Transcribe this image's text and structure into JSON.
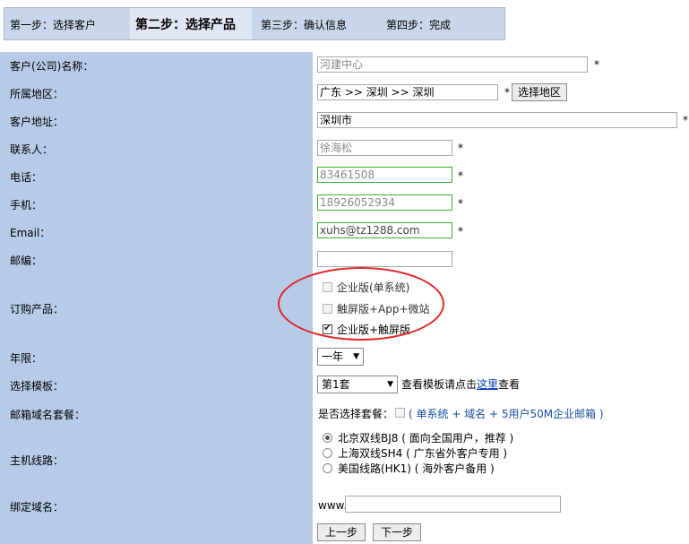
{
  "steps": {
    "step1": "第一步：选择客户",
    "step2": "第二步：选择产品",
    "step3": "第三步：确认信息",
    "step4": "第四步：完成"
  },
  "form": {
    "company": {
      "label": "客户(公司)名称：",
      "value": "河建中心",
      "required": "*"
    },
    "region": {
      "label": "所属地区：",
      "value": "广东 >> 深圳 >> 深圳",
      "required": "*",
      "button": "选择地区"
    },
    "address": {
      "label": "客户地址：",
      "value": "深圳市",
      "required": "*"
    },
    "contact": {
      "label": "联系人：",
      "value": "徐海松",
      "required": "*"
    },
    "phone": {
      "label": "电话：",
      "value": "83461508",
      "required": "*"
    },
    "mobile": {
      "label": "手机：",
      "value": "18926052934",
      "required": "*"
    },
    "email": {
      "label": "Email：",
      "value": "xuhs@tz1288.com",
      "required": "*"
    },
    "postcode": {
      "label": "邮编：",
      "value": ""
    },
    "products": {
      "label": "订购产品：",
      "options": [
        {
          "label": "企业版(单系统)",
          "checked": false,
          "disabled": true
        },
        {
          "label": "触屏版+App+微站",
          "checked": false,
          "disabled": true
        },
        {
          "label": "企业版+触屏版",
          "checked": true,
          "disabled": false
        }
      ]
    },
    "years": {
      "label": "年限：",
      "value": "一年"
    },
    "template": {
      "label": "选择模板：",
      "value": "第1套",
      "hint_before": "查看模板请点击",
      "hint_link": "这里",
      "hint_after": "查看"
    },
    "mail_package": {
      "label": "邮箱域名套餐：",
      "question": "是否选择套餐：",
      "desc": "( 单系统 + 域名 + 5用户50M企业邮箱 )"
    },
    "host_line": {
      "label": "主机线路：",
      "options": [
        {
          "label": "北京双线BJ8 ( 面向全国用户，推荐 )",
          "selected": true
        },
        {
          "label": "上海双线SH4 ( 广东省外客户专用 )",
          "selected": false
        },
        {
          "label": "美国线路(HK1) ( 海外客户备用 )",
          "selected": false
        }
      ]
    },
    "domain": {
      "label": "绑定域名：",
      "prefix": "www.",
      "value": ""
    },
    "prev_button": "上一步",
    "next_button": "下一步"
  },
  "colors": {
    "left_column": "#b7cbe9",
    "steps_bar": "#c9d6ea",
    "highlight_circle": "#e0262a",
    "valid_border": "#33b42e"
  }
}
